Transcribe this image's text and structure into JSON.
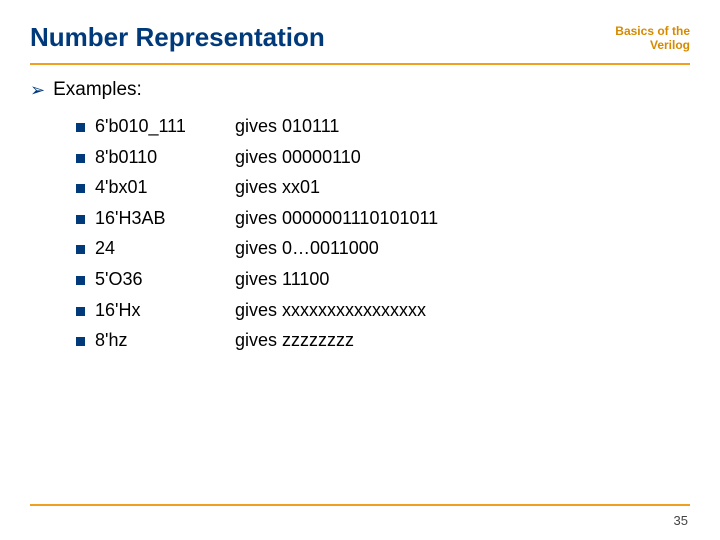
{
  "header": {
    "title": "Number Representation",
    "breadcrumb_line1": "Basics of the",
    "breadcrumb_line2": "Verilog"
  },
  "content": {
    "examples_label": "Examples:",
    "rows": [
      {
        "lhs": "6'b010_111",
        "rhs": "gives 010111"
      },
      {
        "lhs": "8'b0110",
        "rhs": "gives 00000110"
      },
      {
        "lhs": "4'bx01",
        "rhs": "gives xx01"
      },
      {
        "lhs": "16'H3AB",
        "rhs": "gives 0000001110101011"
      },
      {
        "lhs": "24",
        "rhs": "gives 0…0011000"
      },
      {
        "lhs": "5'O36",
        "rhs": "gives 11100"
      },
      {
        "lhs": "16'Hx",
        "rhs": "gives xxxxxxxxxxxxxxxx"
      },
      {
        "lhs": "8'hz",
        "rhs": "gives zzzzzzzz"
      }
    ]
  },
  "footer": {
    "page_number": "35"
  }
}
